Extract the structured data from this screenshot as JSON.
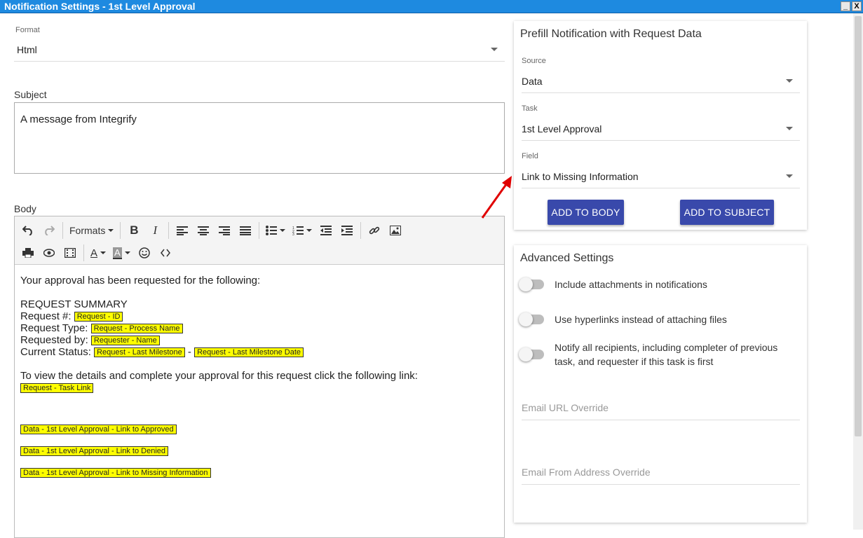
{
  "window": {
    "title": "Notification Settings - 1st Level Approval",
    "minimize": "_",
    "close": "X"
  },
  "format": {
    "label": "Format",
    "value": "Html"
  },
  "subject": {
    "label": "Subject",
    "value": "A message from Integrify"
  },
  "body": {
    "label": "Body",
    "toolbar": {
      "formats_label": "Formats",
      "row1": [
        "undo-icon",
        "redo-icon",
        "formats-dropdown",
        "bold-icon",
        "italic-icon",
        "align-left-icon",
        "align-center-icon",
        "align-right-icon",
        "align-justify-icon",
        "bullet-list-icon",
        "numbered-list-icon",
        "outdent-icon",
        "indent-icon",
        "link-icon",
        "image-icon"
      ],
      "row2": [
        "print-icon",
        "preview-icon",
        "media-icon",
        "text-color-icon",
        "background-color-icon",
        "emoticon-icon",
        "source-code-icon"
      ]
    },
    "content": {
      "intro": "Your approval has been requested for the following:",
      "summary_heading": "REQUEST SUMMARY",
      "request_num_label": "Request #:",
      "request_num_tag": "Request - ID",
      "request_type_label": "Request Type:",
      "request_type_tag": "Request - Process Name",
      "requested_by_label": "Requested by:",
      "requested_by_tag": "Requester - Name",
      "current_status_label": "Current Status:",
      "current_status_tag": "Request - Last Milestone",
      "status_dash": "-",
      "current_status_date_tag": "Request - Last Milestone Date",
      "view_text": "To view the details and complete your approval for this request click the following link:",
      "task_link_tag": "Request - Task Link",
      "approved_tag": "Data - 1st Level Approval - Link to Approved",
      "denied_tag": "Data - 1st Level Approval - Link to Denied",
      "missing_tag": "Data - 1st Level Approval - Link to Missing Information"
    }
  },
  "prefill": {
    "title": "Prefill Notification with Request Data",
    "source": {
      "label": "Source",
      "value": "Data"
    },
    "task": {
      "label": "Task",
      "value": "1st Level Approval"
    },
    "field": {
      "label": "Field",
      "value": "Link to Missing Information"
    },
    "add_to_body": "ADD TO BODY",
    "add_to_subject": "ADD TO SUBJECT"
  },
  "advanced": {
    "title": "Advanced Settings",
    "toggle1": "Include attachments in notifications",
    "toggle2": "Use hyperlinks instead of attaching files",
    "toggle3": "Notify all recipients, including completer of previous task, and requester if this task is first",
    "email_url_placeholder": "Email URL Override",
    "email_from_placeholder": "Email From Address Override"
  },
  "colors": {
    "titlebar": "#1e8ae0",
    "button": "#3949ab",
    "highlight": "#ffff00",
    "arrow": "#e00000"
  }
}
